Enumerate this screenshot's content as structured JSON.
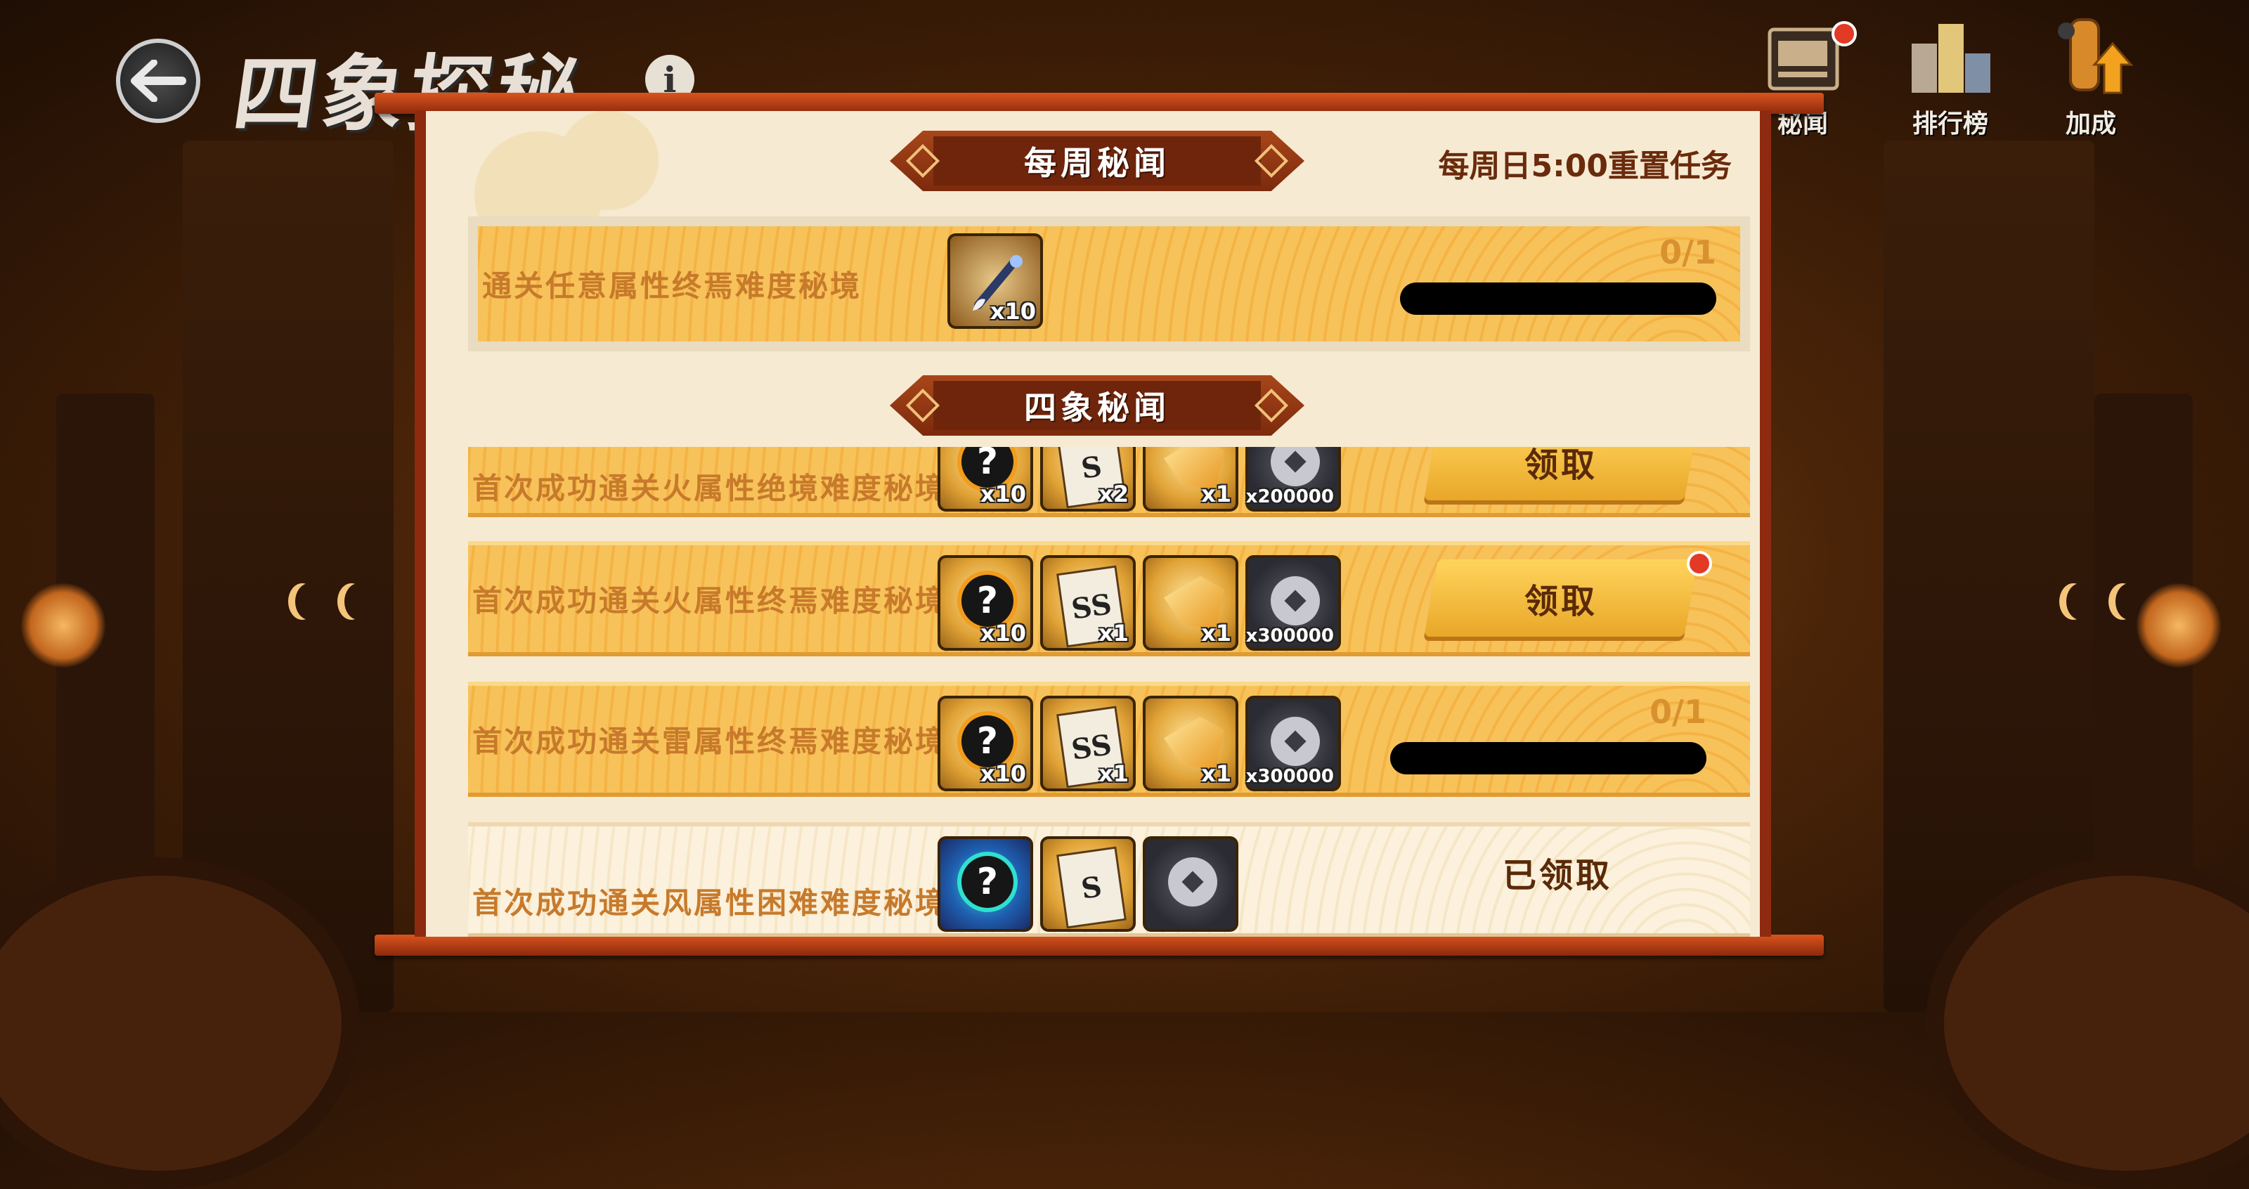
{
  "header": {
    "title": "四象探秘",
    "info_symbol": "i"
  },
  "top_icons": [
    {
      "name": "secret-news",
      "label": "秘闻",
      "has_badge": true
    },
    {
      "name": "ranking",
      "label": "排行榜",
      "has_badge": false
    },
    {
      "name": "bonus",
      "label": "加成",
      "has_badge": false
    }
  ],
  "weekly_section": {
    "title": "每周秘闻",
    "reset_text": "每周日5:00重置任务",
    "task": {
      "label": "通关任意属性终焉难度秘境",
      "rewards": [
        {
          "icon": "brush-icon",
          "qty": "x10"
        }
      ],
      "progress_text": "0/1",
      "progress": 0
    }
  },
  "four_symbols_section": {
    "title": "四象秘闻",
    "tasks": [
      {
        "label": "首次成功通关火属性绝境难度秘境",
        "rewards": [
          {
            "icon": "mystery-orb-icon",
            "qty": "x10"
          },
          {
            "icon": "s-scroll-icon",
            "qty": "x2",
            "mark": "S"
          },
          {
            "icon": "golden-key-icon",
            "qty": "x1"
          },
          {
            "icon": "silver-coin-icon",
            "qty": "x200000"
          }
        ],
        "state": "claimable",
        "button_label": "领取"
      },
      {
        "label": "首次成功通关火属性终焉难度秘境",
        "rewards": [
          {
            "icon": "mystery-orb-icon",
            "qty": "x10"
          },
          {
            "icon": "ss-scroll-icon",
            "qty": "x1",
            "mark": "SS"
          },
          {
            "icon": "golden-key-icon",
            "qty": "x1"
          },
          {
            "icon": "silver-coin-icon",
            "qty": "x300000"
          }
        ],
        "state": "claimable",
        "button_label": "领取",
        "has_badge": true
      },
      {
        "label": "首次成功通关雷属性终焉难度秘境",
        "rewards": [
          {
            "icon": "mystery-orb-icon",
            "qty": "x10"
          },
          {
            "icon": "ss-scroll-icon",
            "qty": "x1",
            "mark": "SS"
          },
          {
            "icon": "golden-key-icon",
            "qty": "x1"
          },
          {
            "icon": "silver-coin-icon",
            "qty": "x300000"
          }
        ],
        "state": "in_progress",
        "progress_text": "0/1",
        "progress": 0
      },
      {
        "label": "首次成功通关风属性困难难度秘境",
        "rewards": [
          {
            "icon": "blue-mystery-orb-icon",
            "qty": ""
          },
          {
            "icon": "s-scroll-icon",
            "qty": "",
            "mark": "S"
          },
          {
            "icon": "silver-coin-icon",
            "qty": ""
          }
        ],
        "state": "claimed",
        "claimed_label": "已领取"
      }
    ]
  },
  "colors": {
    "accent_red": "#e23a24",
    "row_gold": "#f4b344",
    "banner_brown": "#7c2a0c",
    "label_orange": "#c77a2b"
  }
}
